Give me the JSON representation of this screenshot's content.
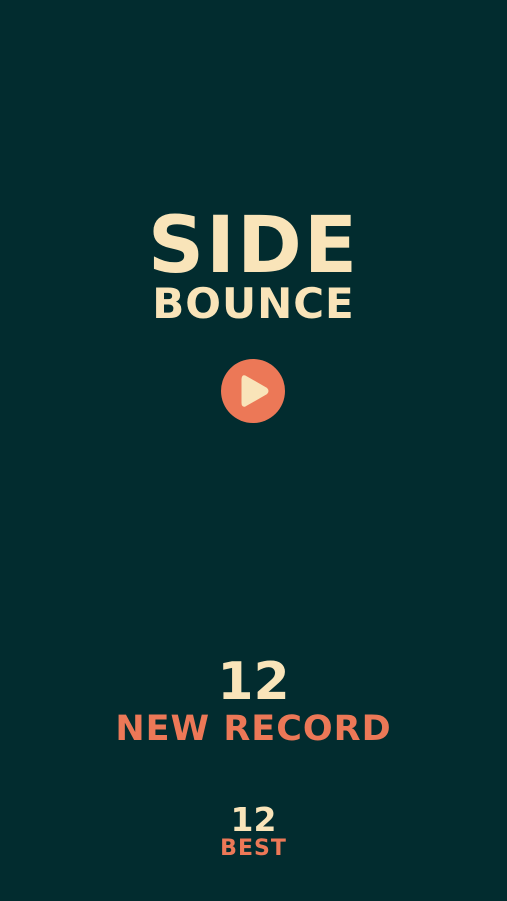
{
  "game": {
    "title_line1": "SIDE",
    "title_line2": "BOUNCE"
  },
  "play_button": {
    "icon": "play-icon"
  },
  "score": {
    "current": "12",
    "status": "NEW RECORD"
  },
  "best": {
    "value": "12",
    "label": "BEST"
  },
  "colors": {
    "background": "#022c2f",
    "cream": "#f9e4b9",
    "accent": "#ec7857"
  }
}
